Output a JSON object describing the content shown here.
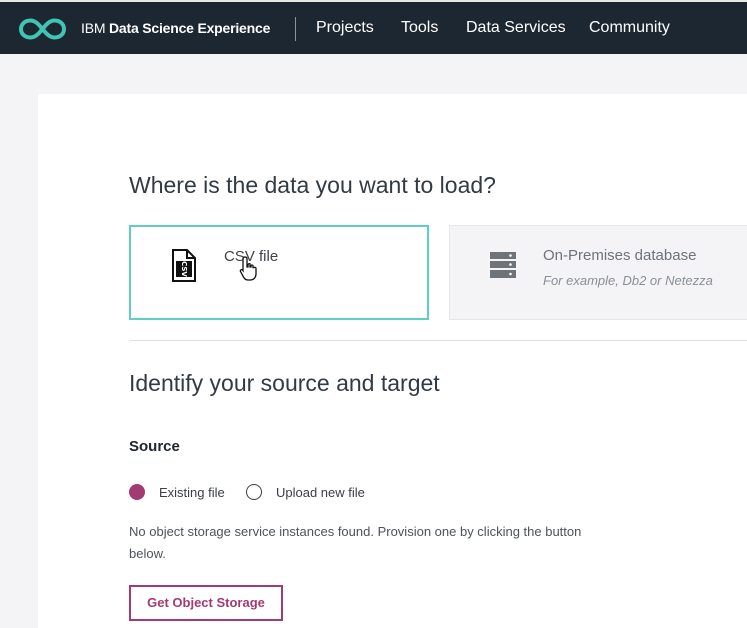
{
  "header": {
    "brand_prefix": "IBM",
    "brand_name": "Data Science Experience",
    "nav": [
      "Projects",
      "Tools",
      "Data Services",
      "Community"
    ],
    "logo_icon": "infinity-logo-icon",
    "accent": "#40c4b4"
  },
  "load_section": {
    "heading": "Where is the data you want to load?",
    "options": [
      {
        "label": "CSV file",
        "icon": "csv-file-icon",
        "selected": true
      },
      {
        "label": "On-Premises database",
        "description": "For example, Db2 or Netezza",
        "icon": "database-server-icon",
        "selected": false
      }
    ]
  },
  "source_target": {
    "heading": "Identify your source and target",
    "source_label": "Source",
    "radio_options": [
      {
        "label": "Existing file",
        "checked": true
      },
      {
        "label": "Upload new file",
        "checked": false
      }
    ],
    "notice": "No object storage service instances found. Provision one by clicking the button below.",
    "button_label": "Get Object Storage"
  },
  "colors": {
    "header_bg": "#1d2731",
    "selected_border": "#5fcfc2",
    "primary": "#a33a72"
  }
}
